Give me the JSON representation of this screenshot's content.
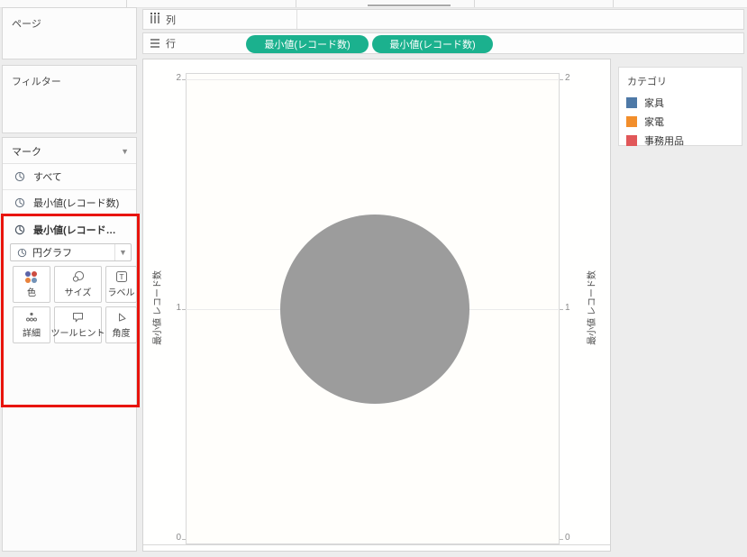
{
  "shelves": {
    "columns_label": "列",
    "rows_label": "行",
    "pills": [
      "最小値(レコード数)",
      "最小値(レコード数)"
    ]
  },
  "sidebar": {
    "pages_label": "ページ",
    "filters_label": "フィルター",
    "marks": {
      "title": "マーク",
      "items": [
        {
          "label": "すべて"
        },
        {
          "label": "最小値(レコード数)"
        },
        {
          "label": "最小値(レコード…"
        }
      ],
      "mark_type": "円グラフ",
      "buttons": [
        {
          "label": "色"
        },
        {
          "label": "サイズ"
        },
        {
          "label": "ラベル"
        },
        {
          "label": "詳細"
        },
        {
          "label": "ツールヒント"
        },
        {
          "label": "角度"
        }
      ]
    }
  },
  "legend": {
    "title": "カテゴリ",
    "items": [
      {
        "label": "家具",
        "color": "#4e79a7"
      },
      {
        "label": "家電",
        "color": "#f28e2b"
      },
      {
        "label": "事務用品",
        "color": "#e15759"
      }
    ]
  },
  "axes": {
    "left_title": "最小値 レコード数",
    "right_title": "最小値 レコード数",
    "ticks": [
      "2",
      "1",
      "0"
    ]
  },
  "chart_data": {
    "type": "pie",
    "title": "",
    "series": [
      {
        "name": "最小値(レコード数)",
        "values": [
          1
        ]
      }
    ],
    "y_axis": {
      "title": "最小値 レコード数",
      "range": [
        0,
        2
      ],
      "ticks": [
        0,
        1,
        2
      ]
    },
    "dual_axis": true,
    "grid": true,
    "mark": {
      "shape": "circle",
      "color": "#9c9c9c",
      "center_value": 1
    }
  },
  "colors": {
    "pill_green": "#1bb18e",
    "highlight_red": "#e8140c",
    "circle_gray": "#9c9c9c",
    "color_icon_dots": [
      "#5b64a8",
      "#cc4c41",
      "#e8823c",
      "#7292b7"
    ]
  }
}
